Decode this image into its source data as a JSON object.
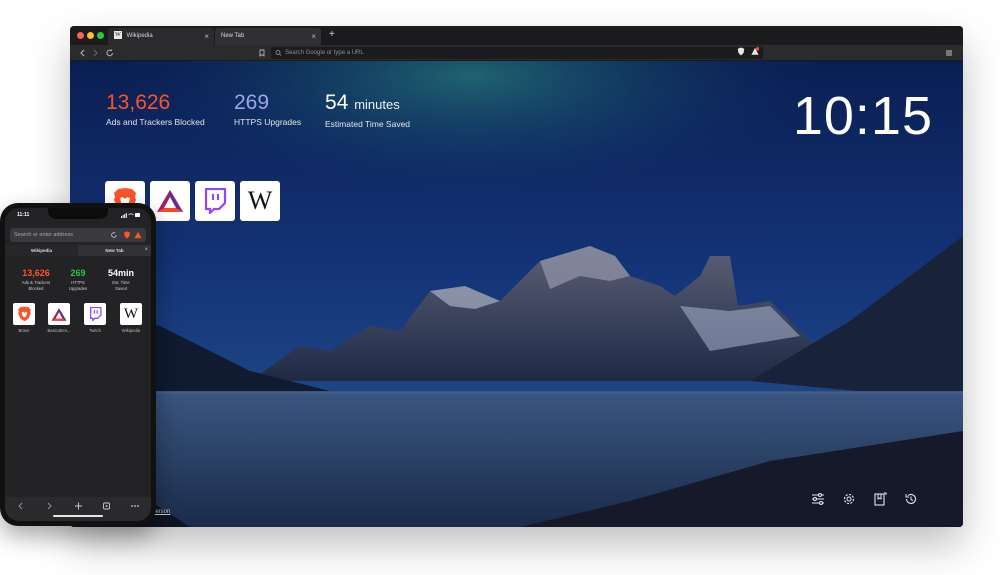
{
  "desktop": {
    "tabs": [
      {
        "label": "Wikipedia",
        "favicon": "W"
      },
      {
        "label": "New Tab"
      }
    ],
    "new_tab_symbol": "+",
    "tab_close_symbol": "×",
    "url_placeholder": "Search Google or type a URL",
    "stats": {
      "ads_count": "13,626",
      "ads_label": "Ads and Trackers Blocked",
      "https_count": "269",
      "https_label": "HTTPS Upgrades",
      "time_value": "54",
      "time_unit": "minutes",
      "time_label": "Estimated Time Saved"
    },
    "clock": "10:15",
    "tiles": [
      {
        "icon": "brave-lion-icon"
      },
      {
        "icon": "bat-triangle-icon"
      },
      {
        "icon": "twitch-icon"
      },
      {
        "icon": "wikipedia-w-icon",
        "letter": "W"
      }
    ],
    "photo_credit": "derson",
    "bottom_icons": [
      "sliders-icon",
      "settings-icon",
      "bookmarks-icon",
      "history-icon"
    ],
    "shield_badge": "1"
  },
  "phone": {
    "time": "11:11",
    "url_placeholder": "Search or enter address",
    "tabs": [
      {
        "label": "Wikipedia"
      },
      {
        "label": "New Tab"
      }
    ],
    "stats": [
      {
        "value": "13,626",
        "label_line1": "Ads & Trackers",
        "label_line2": "Blocked",
        "color": "#fb542b"
      },
      {
        "value": "269",
        "label_line1": "HTTPS",
        "label_line2": "Upgrades",
        "color": "#2fbf4f"
      },
      {
        "value": "54min",
        "label_line1": "Est. Time",
        "label_line2": "Saved",
        "color": "#ffffff"
      }
    ],
    "tiles": [
      {
        "label": "Brave",
        "icon": "brave-lion-icon"
      },
      {
        "label": "Basicatten...",
        "icon": "bat-triangle-icon"
      },
      {
        "label": "Twitch",
        "icon": "twitch-icon"
      },
      {
        "label": "Wikipedia",
        "icon": "wikipedia-w-icon",
        "letter": "W"
      }
    ],
    "bottom_bar": [
      "back-icon",
      "forward-icon",
      "add-icon",
      "tabs-icon",
      "more-icon"
    ]
  },
  "colors": {
    "brave_orange": "#fb542b",
    "https_purple": "#a0a5eb",
    "phone_https_green": "#2fbf4f",
    "twitch_purple": "#9146ff"
  }
}
